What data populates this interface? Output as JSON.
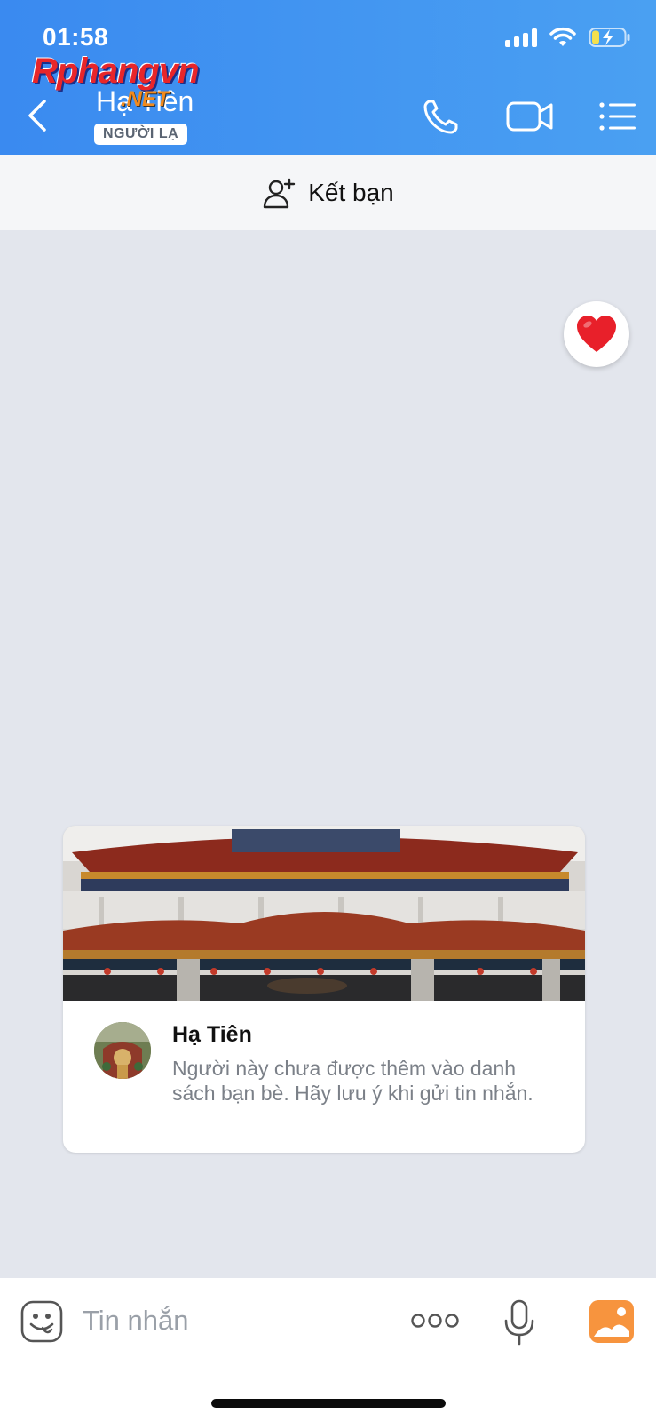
{
  "status_bar": {
    "time": "01:58"
  },
  "watermark": {
    "main": "Rphangvn",
    "sub": ".NET"
  },
  "header": {
    "contact_name": "Hạ Tiên",
    "badge": "NGƯỜI LẠ",
    "icons": [
      "back-icon",
      "phone-icon",
      "video-call-icon",
      "menu-list-icon"
    ]
  },
  "add_friend": {
    "label": "Kết bạn",
    "icon": "add-user-icon"
  },
  "reaction": {
    "icon": "heart-icon",
    "color": "#e8202a"
  },
  "profile_card": {
    "name": "Hạ Tiên",
    "message": "Người này chưa được thêm vào danh sách bạn bè. Hãy lưu ý khi gửi tin nhắn."
  },
  "composer": {
    "placeholder": "Tin nhắn",
    "icons": [
      "sticker-icon",
      "more-icon",
      "microphone-icon",
      "image-icon"
    ]
  },
  "colors": {
    "header_blue": "#3a8af0",
    "accent_orange": "#f7943e",
    "background": "#e3e6ed"
  }
}
